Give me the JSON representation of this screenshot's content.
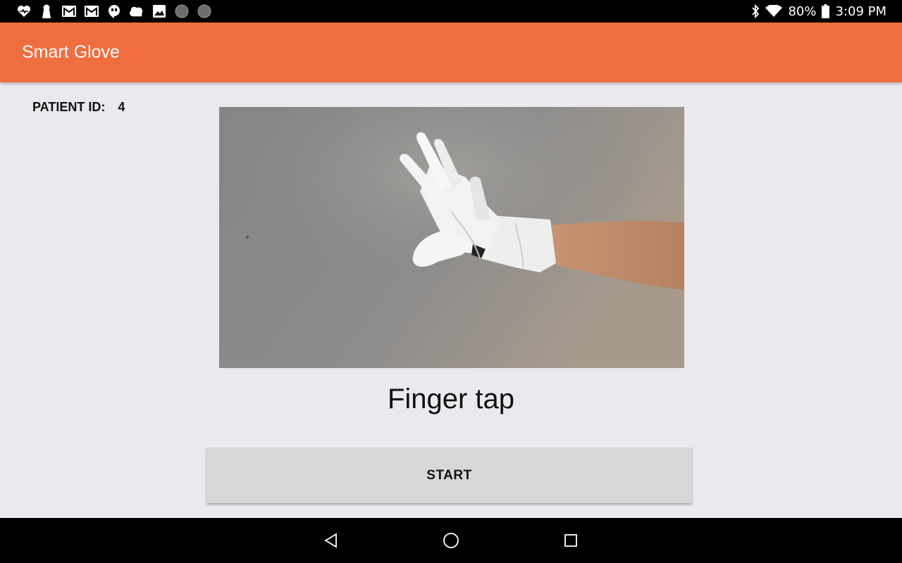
{
  "status_bar": {
    "notification_icons": [
      "pulse-heart-icon",
      "keyhole-icon",
      "gmail-icon",
      "gmail-icon",
      "hangouts-icon",
      "cloud-icon",
      "gallery-icon",
      "dot-icon",
      "dot-icon"
    ],
    "battery": "80%",
    "time": "3:09 PM"
  },
  "app_bar": {
    "title": "Smart Glove",
    "color": "#ee6e3f"
  },
  "patient": {
    "label": "PATIENT ID:",
    "value": "4"
  },
  "exercise": {
    "name": "Finger tap"
  },
  "actions": {
    "start_label": "START"
  },
  "nav_bar": {
    "buttons": [
      "back-icon",
      "home-icon",
      "recents-icon"
    ]
  }
}
